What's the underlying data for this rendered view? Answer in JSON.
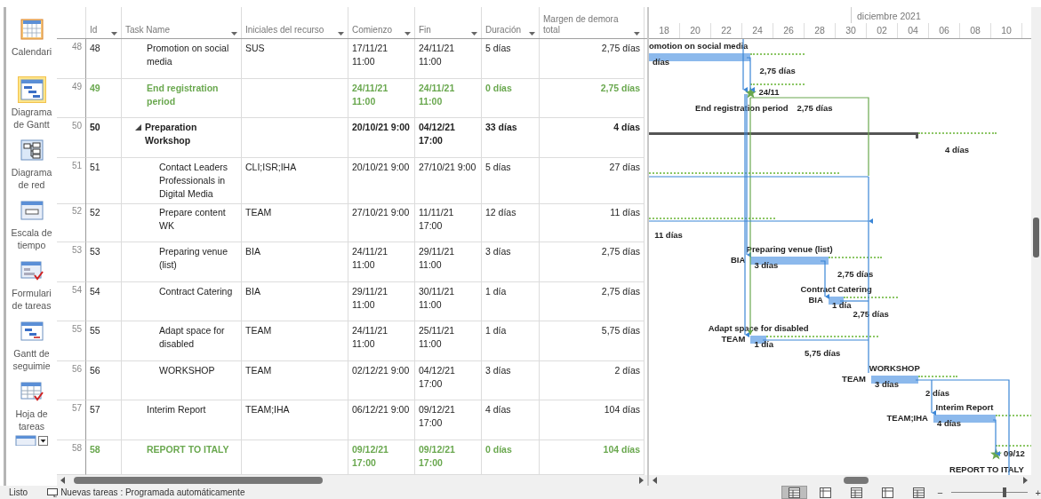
{
  "sidebar": {
    "items": [
      {
        "label": "Calendari",
        "selected": false
      },
      {
        "label": "Diagrama de Gantt",
        "selected": true
      },
      {
        "label": "Diagrama de red",
        "selected": false
      },
      {
        "label": "Escala de tiempo",
        "selected": false
      },
      {
        "label": "Formulari de tareas",
        "selected": false
      },
      {
        "label": "Gantt de seguimie",
        "selected": false
      },
      {
        "label": "Hoja de tareas",
        "selected": false
      }
    ]
  },
  "table": {
    "columns": [
      "Id",
      "Task Name",
      "Iniciales del recurso",
      "Comienzo",
      "Fin",
      "Duración",
      "Margen de demora total"
    ],
    "rows": [
      {
        "row_number": "48",
        "id": "48",
        "kind": "task",
        "task": "Promotion on social media",
        "resource": "SUS",
        "start": "17/11/21 11:00",
        "finish": "24/11/21 11:00",
        "duration": "5 días",
        "slack": "2,75 días",
        "gantt": {
          "name_label": "omotion on social media",
          "bar_label": "días",
          "slack_label": "2,75 días"
        }
      },
      {
        "row_number": "49",
        "id": "49",
        "kind": "milestone",
        "task": "End registration period",
        "start": "24/11/21 11:00",
        "finish": "24/11/21 11:00",
        "duration": "0 días",
        "slack": "2,75 días",
        "gantt": {
          "date_label": "24/11",
          "name_label": "End registration period",
          "slack_label": "2,75 días"
        }
      },
      {
        "row_number": "50",
        "id": "50",
        "kind": "summary",
        "expanded": true,
        "task": "Preparation Workshop",
        "start": "20/10/21 9:00",
        "finish": "04/12/21 17:00",
        "duration": "33 días",
        "slack": "4 días",
        "gantt": {
          "slack_label": "4 días"
        },
        "children": [
          {
            "row_number": "51",
            "id": "51",
            "kind": "task",
            "task": "Contact Leaders Professionals in Digital Media",
            "resource": "CLI;ISR;IHA",
            "start": "20/10/21 9:00",
            "finish": "27/10/21 9:00",
            "duration": "5 días",
            "slack": "27 días"
          },
          {
            "row_number": "52",
            "id": "52",
            "kind": "task",
            "task": "Prepare content WK",
            "resource": "TEAM",
            "start": "27/10/21 9:00",
            "finish": "11/11/21 17:00",
            "duration": "12 días",
            "slack": "11 días",
            "gantt": {
              "slack_label": "11 días"
            }
          },
          {
            "row_number": "53",
            "id": "53",
            "kind": "task",
            "task": "Preparing venue (list)",
            "resource": "BIA",
            "start": "24/11/21 11:00",
            "finish": "29/11/21 11:00",
            "duration": "3 días",
            "slack": "2,75 días",
            "gantt": {
              "name_label": "Preparing venue (list)",
              "resource_label": "BIA",
              "bar_label": "3 días",
              "slack_label": "2,75 días"
            }
          },
          {
            "row_number": "54",
            "id": "54",
            "kind": "task",
            "task": "Contract Catering",
            "resource": "BIA",
            "start": "29/11/21 11:00",
            "finish": "30/11/21 11:00",
            "duration": "1 día",
            "slack": "2,75 días",
            "gantt": {
              "name_label": "Contract Catering",
              "resource_label": "BIA",
              "bar_label": "1 día",
              "slack_label": "2,75 días"
            }
          },
          {
            "row_number": "55",
            "id": "55",
            "kind": "task",
            "task": "Adapt space for disabled",
            "resource": "TEAM",
            "start": "24/11/21 11:00",
            "finish": "25/11/21 11:00",
            "duration": "1 día",
            "slack": "5,75 días",
            "gantt": {
              "name_label": "Adapt space for disabled",
              "resource_label": "TEAM",
              "bar_label": "1 día",
              "slack_label": "5,75 días"
            }
          },
          {
            "row_number": "56",
            "id": "56",
            "kind": "task",
            "task": "WORKSHOP",
            "resource": "TEAM",
            "start": "02/12/21 9:00",
            "finish": "04/12/21 17:00",
            "duration": "3 días",
            "slack": "2 días",
            "gantt": {
              "name_label": "WORKSHOP",
              "resource_label": "TEAM",
              "bar_label": "3 días",
              "slack_label": "2 días"
            }
          }
        ]
      },
      {
        "row_number": "57",
        "id": "57",
        "kind": "task",
        "task": "Interim Report",
        "resource": "TEAM;IHA",
        "start": "06/12/21 9:00",
        "finish": "09/12/21 17:00",
        "duration": "4 días",
        "slack": "104 días",
        "gantt": {
          "name_label": "Interim Report",
          "resource_label": "TEAM;IHA",
          "bar_label": "4 días"
        }
      },
      {
        "row_number": "58",
        "id": "58",
        "kind": "milestone",
        "task": "REPORT TO ITALY",
        "start": "09/12/21 17:00",
        "finish": "09/12/21 17:00",
        "duration": "0 días",
        "slack": "104 días",
        "gantt": {
          "date_label": "09/12",
          "name_label": "REPORT TO ITALY"
        }
      }
    ]
  },
  "timeline": {
    "month": "diciembre 2021",
    "days": [
      "18",
      "20",
      "22",
      "24",
      "26",
      "28",
      "30",
      "02",
      "04",
      "06",
      "08",
      "10"
    ]
  },
  "status_bar": {
    "state": "Listo",
    "task_mode": "Nuevas tareas : Programada automáticamente",
    "views": [
      {
        "selected": true
      },
      {
        "selected": false
      },
      {
        "selected": false
      },
      {
        "selected": false
      },
      {
        "selected": false
      }
    ],
    "zoom": {
      "minus": "−",
      "plus": "+",
      "level": 0.68
    }
  }
}
